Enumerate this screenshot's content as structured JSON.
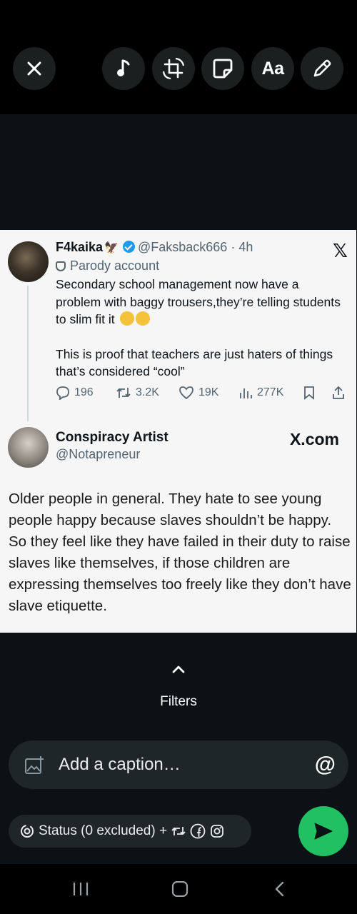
{
  "toolbar": {
    "close_icon": "close-icon",
    "music_icon": "music-icon",
    "crop_rotate_icon": "crop-rotate-icon",
    "sticker_icon": "sticker-icon",
    "text_label": "Aa",
    "pencil_icon": "pencil-icon"
  },
  "tweet1": {
    "display_name": "F4kaika",
    "meta": "@Faksback666 · 4h",
    "parody_label": "Parody account",
    "para1": "Secondary school management now have a problem with baggy trousers,they’re telling students to slim fit it",
    "para2": "This is proof that teachers are just haters of things that’s considered “cool”",
    "replies": "196",
    "reposts": "3.2K",
    "likes": "19K",
    "views": "277K"
  },
  "tweet2": {
    "display_name": "Conspiracy Artist",
    "handle": "@Notapreneur",
    "watermark": "X.com",
    "body": "Older people in general. They hate to see young people happy because slaves shouldn’t be happy. So they feel like they have failed in their duty to raise slaves like themselves, if those children are expressing themselves too freely like they don’t have slave etiquette."
  },
  "filters": {
    "label": "Filters"
  },
  "caption": {
    "placeholder": "Add a caption…"
  },
  "status": {
    "label": "Status (0 excluded) +"
  },
  "colors": {
    "send": "#21c063",
    "pill": "#1f2628",
    "stage": "#0b1115",
    "verified": "#1d9bf0"
  }
}
